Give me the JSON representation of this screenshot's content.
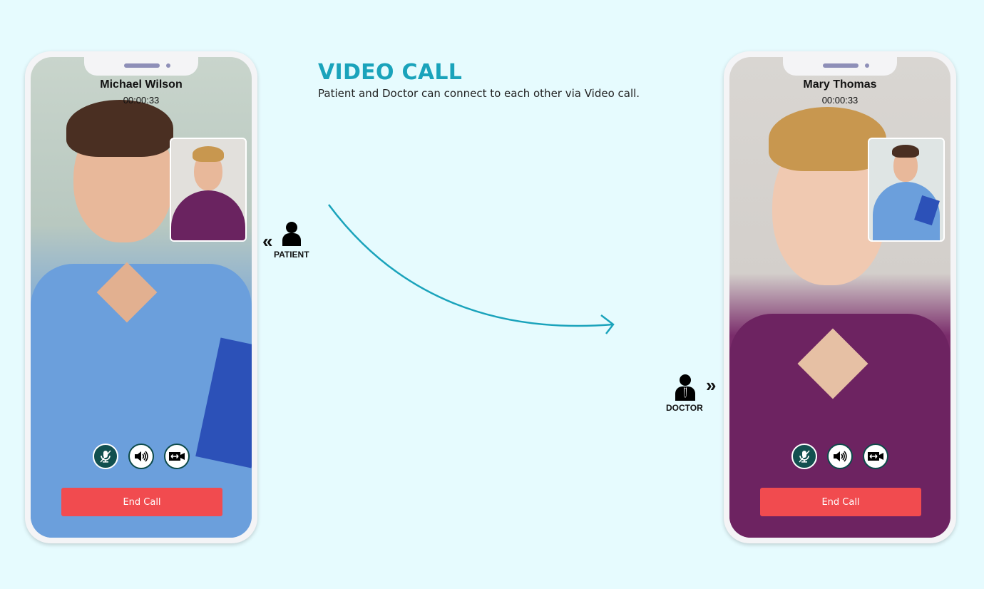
{
  "header": {
    "title": "VIDEO CALL",
    "subtitle": "Patient and Doctor can connect to each other via Video call."
  },
  "colors": {
    "accent": "#1aa3bb",
    "background": "#e6fbfe",
    "end_call": "#f14b4f",
    "mute_button": "#12504f"
  },
  "patient_phone": {
    "caller_name": "Michael Wilson",
    "call_duration": "00:00:33",
    "controls": {
      "mute": "mic-off-icon",
      "speaker": "speaker-icon",
      "switch_camera": "switch-camera-icon"
    },
    "end_call_label": "End Call"
  },
  "doctor_phone": {
    "caller_name": "Mary Thomas",
    "call_duration": "00:00:33",
    "controls": {
      "mute": "mic-off-icon",
      "speaker": "speaker-icon",
      "switch_camera": "switch-camera-icon"
    },
    "end_call_label": "End Call"
  },
  "labels": {
    "patient": "PATIENT",
    "doctor": "DOCTOR",
    "left_chevrons": "«",
    "right_chevrons": "»"
  }
}
